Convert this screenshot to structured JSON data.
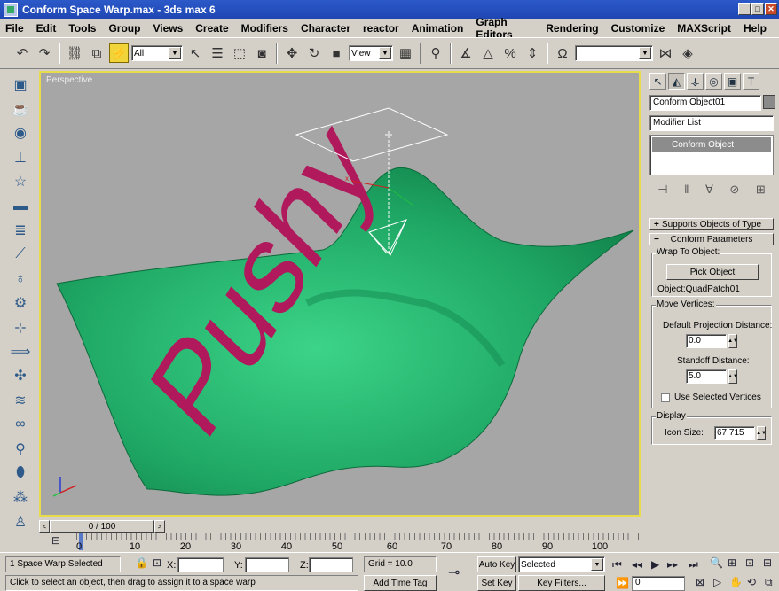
{
  "window": {
    "title": "Conform Space Warp.max - 3ds max 6"
  },
  "menu": [
    "File",
    "Edit",
    "Tools",
    "Group",
    "Views",
    "Create",
    "Modifiers",
    "Character",
    "reactor",
    "Animation",
    "Graph Editors",
    "Rendering",
    "Customize",
    "MAXScript",
    "Help"
  ],
  "toolbar": {
    "selection_filter": "All",
    "ref_coord": "View",
    "named_selection": ""
  },
  "viewport": {
    "label": "Perspective",
    "surface_text": "Pushy",
    "colors": {
      "surface": "#1fa865",
      "text": "#b01a5c",
      "border": "#e8dc4a"
    }
  },
  "panel": {
    "object_name": "Conform Object01",
    "modifier_list": "Modifier List",
    "stack_item": "Conform Object",
    "rollout_supports": "Supports Objects of Type",
    "rollout_params": "Conform Parameters",
    "wrap_group": "Wrap To Object:",
    "pick_button": "Pick Object",
    "object_label": "Object:QuadPatch01",
    "move_group": "Move Vertices:",
    "default_proj_label": "Default Projection Distance:",
    "default_proj_value": "0.0",
    "standoff_label": "Standoff Distance:",
    "standoff_value": "5.0",
    "use_selected_label": "Use Selected Vertices",
    "display_group": "Display",
    "icon_size_label": "Icon Size:",
    "icon_size_value": "67.715"
  },
  "timeline": {
    "frame_display": "0 / 100",
    "ticks": [
      "0",
      "10",
      "20",
      "30",
      "40",
      "50",
      "60",
      "70",
      "80",
      "90",
      "100"
    ]
  },
  "status": {
    "selection": "1 Space Warp Selected",
    "prompt": "Click to select an object, then drag to assign it to a space warp",
    "x_label": "X:",
    "y_label": "Y:",
    "z_label": "Z:",
    "grid": "Grid = 10.0",
    "add_time_tag": "Add Time Tag",
    "auto_key": "Auto Key",
    "set_key": "Set Key",
    "key_mode": "Selected",
    "key_filters": "Key Filters...",
    "frame_field": "0"
  }
}
